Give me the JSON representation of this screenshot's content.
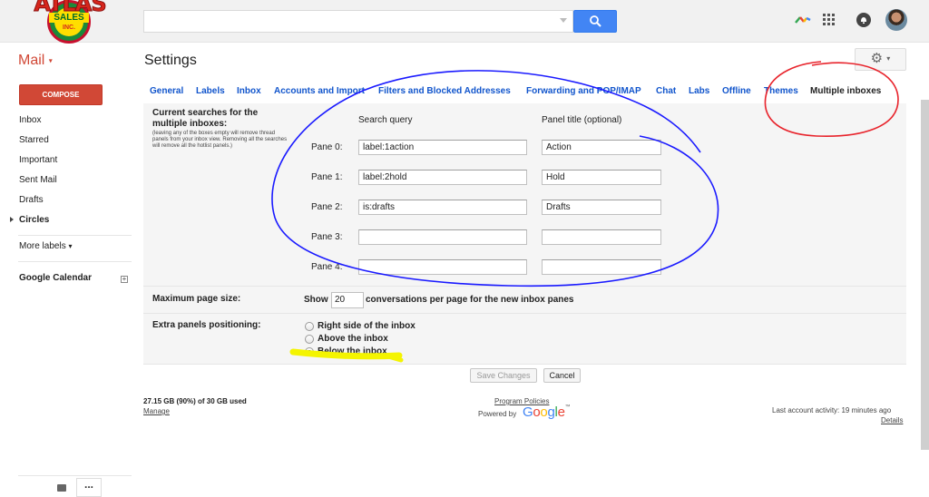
{
  "header": {
    "logo_word": "ATLAS",
    "logo_sub": "SALES",
    "logo_sub2": "INC.",
    "search_placeholder": "",
    "icons": [
      "search-icon",
      "apps-grid-icon",
      "notifications-icon",
      "avatar"
    ]
  },
  "subbar": {
    "mail_label": "Mail",
    "title": "Settings",
    "gear": "⚙"
  },
  "sidebar": {
    "compose": "COMPOSE",
    "items": [
      "Inbox",
      "Starred",
      "Important",
      "Sent Mail",
      "Drafts",
      "Circles"
    ],
    "more_labels": "More labels",
    "calendar": "Google Calendar",
    "plus": "+"
  },
  "tabs": [
    "General",
    "Labels",
    "Inbox",
    "Accounts and Import",
    "Filters and Blocked Addresses",
    "Forwarding and POP/IMAP",
    "Chat",
    "Labs",
    "Offline",
    "Themes",
    "Multiple inboxes"
  ],
  "multiple_inboxes": {
    "section_title": "Current searches for the multiple inboxes:",
    "section_note": "(leaving any of the boxes empty will remove thread panels from your inbox view. Removing all the searches will remove all the hotlist panels.)",
    "col_query": "Search query",
    "col_title": "Panel title (optional)",
    "panes": [
      {
        "label": "Pane 0:",
        "query": "label:1action",
        "title": "Action"
      },
      {
        "label": "Pane 1:",
        "query": "label:2hold",
        "title": "Hold"
      },
      {
        "label": "Pane 2:",
        "query": "is:drafts",
        "title": "Drafts"
      },
      {
        "label": "Pane 3:",
        "query": "",
        "title": ""
      },
      {
        "label": "Pane 4:",
        "query": "",
        "title": ""
      }
    ],
    "max_page_label": "Maximum page size:",
    "show": "Show",
    "show_value": "20",
    "show_suffix": "conversations per page for the new inbox panes",
    "positioning_label": "Extra panels positioning:",
    "options": [
      "Right side of the inbox",
      "Above the inbox",
      "Below the inbox"
    ],
    "selected_option": 2,
    "save": "Save Changes",
    "cancel": "Cancel"
  },
  "footer": {
    "storage": "27.15 GB (90%) of 30 GB used",
    "manage": "Manage",
    "policies": "Program Policies",
    "powered_by": "Powered by",
    "google": "Google",
    "activity": "Last account activity: 19 minutes ago",
    "details": "Details"
  },
  "colors": {
    "accent_red": "#d14836",
    "link_blue": "#1155cc",
    "annotation_blue": "#1a1aff",
    "annotation_red": "#e8242c",
    "highlight_yellow": "#f4f400"
  }
}
